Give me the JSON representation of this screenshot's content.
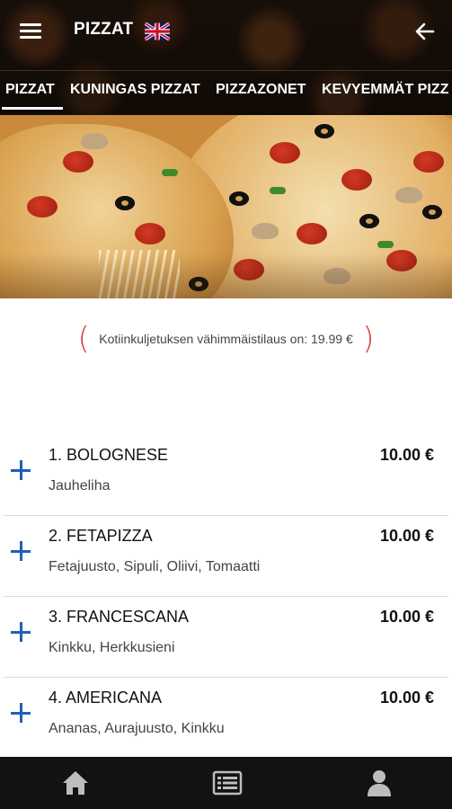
{
  "header": {
    "title": "PIZZAT",
    "flag": "uk-flag-icon",
    "menu_icon": "hamburger-icon",
    "back_icon": "back-arrow-icon"
  },
  "tabs": [
    {
      "label": "PIZZAT",
      "active": true
    },
    {
      "label": "KUNINGAS PIZZAT",
      "active": false
    },
    {
      "label": "PIZZAZONET",
      "active": false
    },
    {
      "label": "KEVYEMMÄT PIZZ",
      "active": false
    }
  ],
  "min_order": {
    "text": "Kotiinkuljetuksen vähimmäistilaus on: 19.99 €",
    "open_paren": "(",
    "close_paren": ")"
  },
  "menu_items": [
    {
      "name": "1. BOLOGNESE",
      "price": "10.00 €",
      "description": "Jauheliha"
    },
    {
      "name": "2. FETAPIZZA",
      "price": "10.00 €",
      "description": "Fetajuusto, Sipuli, Oliivi, Tomaatti"
    },
    {
      "name": "3. FRANCESCANA",
      "price": "10.00 €",
      "description": "Kinkku, Herkkusieni"
    },
    {
      "name": "4. AMERICANA",
      "price": "10.00 €",
      "description": "Ananas, Aurajuusto, Kinkku"
    }
  ],
  "bottom_nav": [
    {
      "icon": "home-icon"
    },
    {
      "icon": "menu-list-icon"
    },
    {
      "icon": "user-icon"
    }
  ],
  "colors": {
    "accent_blue": "#1d62b8",
    "min_order_red": "#d43a3a",
    "bottom_bar": "#121212"
  }
}
